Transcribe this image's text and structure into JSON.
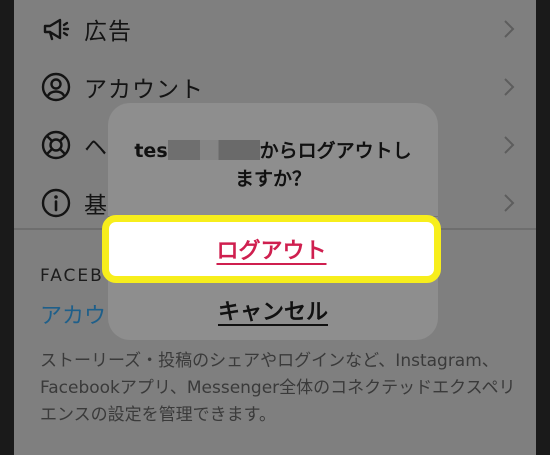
{
  "settings": {
    "items": [
      {
        "label": "広告",
        "icon": "megaphone-icon"
      },
      {
        "label": "アカウント",
        "icon": "account-circle-icon"
      },
      {
        "label": "ヘ",
        "icon": "lifebuoy-help-icon"
      },
      {
        "label": "基",
        "icon": "info-icon"
      }
    ]
  },
  "facebook_section": {
    "title": "FACEB",
    "link": "アカウ",
    "description": "ストーリーズ・投稿のシェアやログインなど、Instagram、Facebookアプリ、Messenger全体のコネクテッドエクスペリエンスの設定を管理できます。"
  },
  "dialog": {
    "message_prefix": "tes",
    "message_suffix": "からログアウトし",
    "message_line2": "ますか？",
    "logout_label": "ログアウト",
    "cancel_label": "キャンセル"
  },
  "colors": {
    "highlight": "#f7ee1c",
    "destructive": "#cf1f4f"
  }
}
